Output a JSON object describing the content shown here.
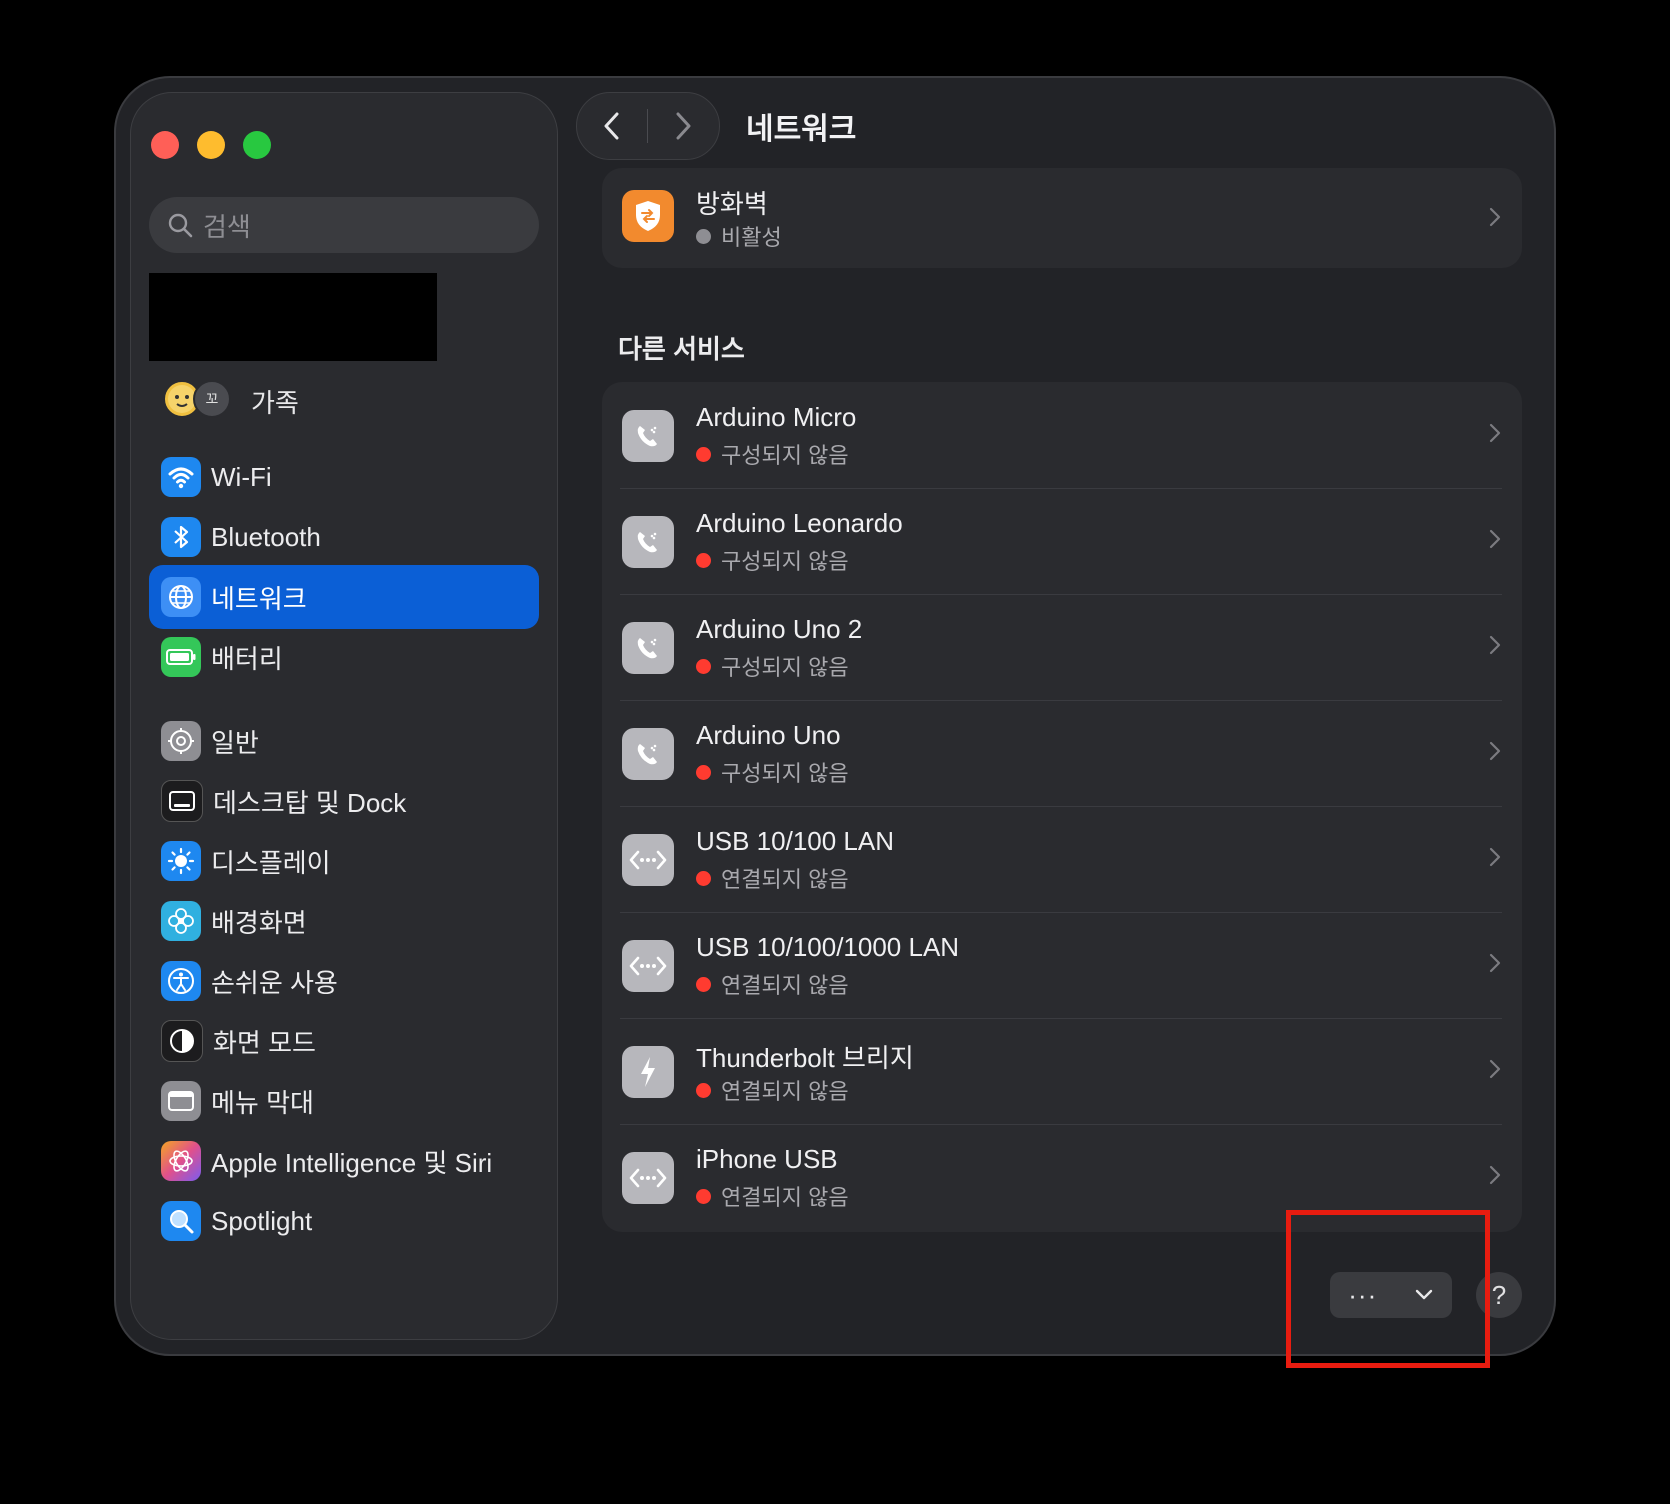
{
  "window": {
    "title": "네트워크"
  },
  "sidebar": {
    "search_placeholder": "검색",
    "family_label": "가족",
    "family_avatar_initial": "꼬",
    "items": [
      {
        "label": "Wi-Fi",
        "icon": "wifi-icon",
        "color": "#1e88f0"
      },
      {
        "label": "Bluetooth",
        "icon": "bluetooth-icon",
        "color": "#1e88f0"
      },
      {
        "label": "네트워크",
        "icon": "globe-icon",
        "color": "#1e88f0",
        "selected": true
      },
      {
        "label": "배터리",
        "icon": "battery-icon",
        "color": "#34c759"
      },
      {
        "label": "일반",
        "icon": "gear-icon",
        "color": "#8e8e93"
      },
      {
        "label": "데스크탑 및 Dock",
        "icon": "dock-icon",
        "color": "#1c1c1e"
      },
      {
        "label": "디스플레이",
        "icon": "sun-icon",
        "color": "#1e88f0"
      },
      {
        "label": "배경화면",
        "icon": "flower-icon",
        "color": "#30b0e0"
      },
      {
        "label": "손쉬운 사용",
        "icon": "accessibility-icon",
        "color": "#1e88f0"
      },
      {
        "label": "화면 모드",
        "icon": "appearance-icon",
        "color": "#1c1c1e"
      },
      {
        "label": "메뉴 막대",
        "icon": "menubar-icon",
        "color": "#8e8e93"
      },
      {
        "label": "Apple Intelligence 및 Siri",
        "icon": "siri-icon",
        "color": "#e0508c"
      },
      {
        "label": "Spotlight",
        "icon": "magnifier-icon",
        "color": "#1e88f0"
      }
    ]
  },
  "firewall": {
    "name": "방화벽",
    "status": "비활성",
    "status_color": "#8e8e93"
  },
  "other_services": {
    "heading": "다른 서비스",
    "rows": [
      {
        "name": "Arduino Micro",
        "status": "구성되지 않음",
        "icon": "modem-icon"
      },
      {
        "name": "Arduino Leonardo",
        "status": "구성되지 않음",
        "icon": "modem-icon"
      },
      {
        "name": "Arduino Uno 2",
        "status": "구성되지 않음",
        "icon": "modem-icon"
      },
      {
        "name": "Arduino Uno",
        "status": "구성되지 않음",
        "icon": "modem-icon"
      },
      {
        "name": "USB 10/100 LAN",
        "status": "연결되지 않음",
        "icon": "ethernet-icon"
      },
      {
        "name": "USB 10/100/1000 LAN",
        "status": "연결되지 않음",
        "icon": "ethernet-icon"
      },
      {
        "name": "Thunderbolt 브리지",
        "status": "연결되지 않음",
        "icon": "thunderbolt-icon"
      },
      {
        "name": "iPhone USB",
        "status": "연결되지 않음",
        "icon": "ethernet-icon"
      }
    ],
    "status_color": "#ff3b30"
  },
  "footer": {
    "more_label": "···",
    "help_label": "?"
  }
}
